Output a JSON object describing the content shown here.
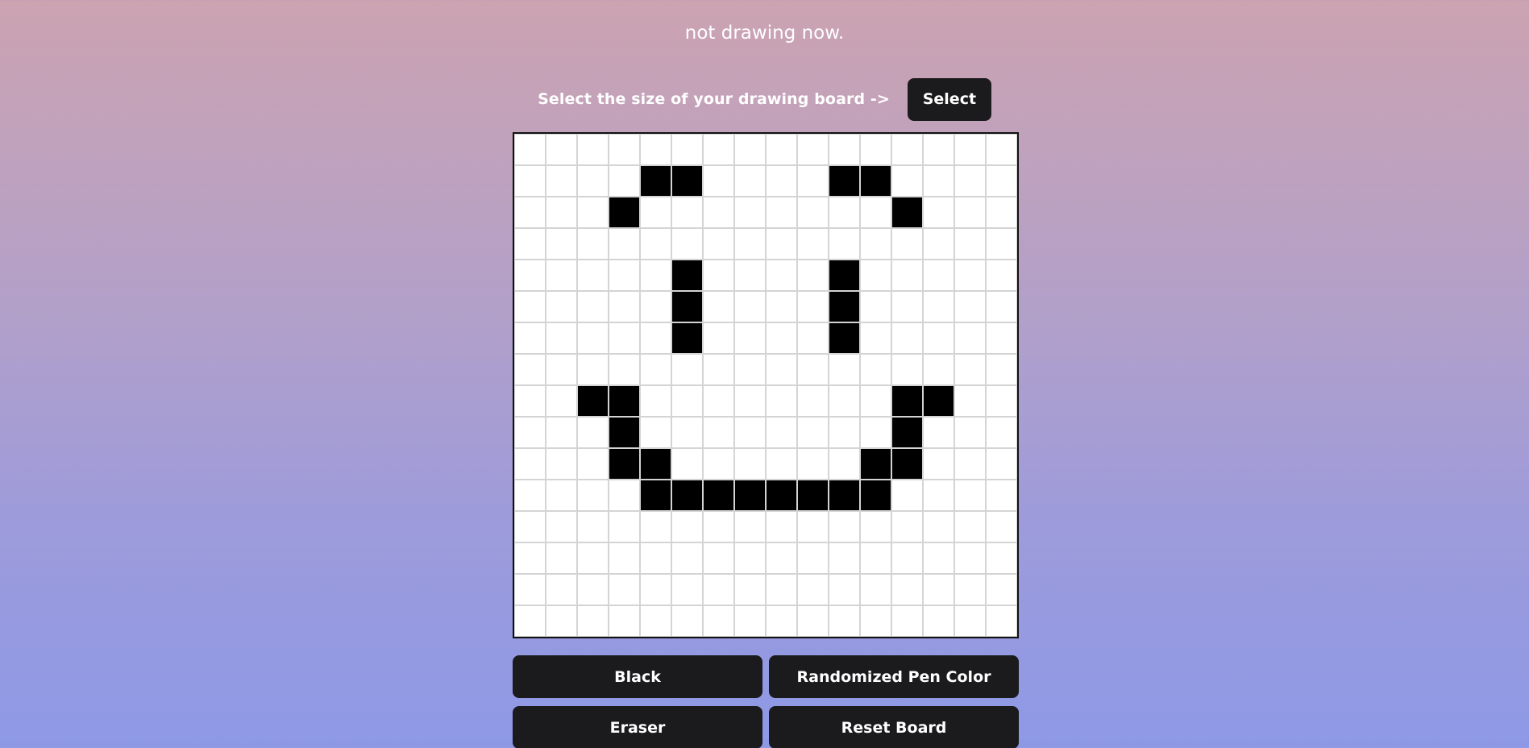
{
  "status": {
    "text": "not drawing now."
  },
  "board_picker": {
    "label": "Select the size of your drawing board ->",
    "button_label": "Select"
  },
  "board": {
    "size": 16,
    "filled_color": "#000000",
    "empty_color": "#ffffff",
    "grid_line_color": "#d4d4d4",
    "filled_cells": [
      [
        1,
        4
      ],
      [
        1,
        5
      ],
      [
        1,
        10
      ],
      [
        1,
        11
      ],
      [
        2,
        3
      ],
      [
        2,
        12
      ],
      [
        4,
        5
      ],
      [
        4,
        10
      ],
      [
        5,
        5
      ],
      [
        5,
        10
      ],
      [
        6,
        5
      ],
      [
        6,
        10
      ],
      [
        8,
        2
      ],
      [
        8,
        3
      ],
      [
        8,
        12
      ],
      [
        8,
        13
      ],
      [
        9,
        3
      ],
      [
        9,
        12
      ],
      [
        10,
        3
      ],
      [
        10,
        4
      ],
      [
        10,
        11
      ],
      [
        10,
        12
      ],
      [
        11,
        4
      ],
      [
        11,
        5
      ],
      [
        11,
        6
      ],
      [
        11,
        7
      ],
      [
        11,
        8
      ],
      [
        11,
        9
      ],
      [
        11,
        10
      ],
      [
        11,
        11
      ]
    ]
  },
  "controls": {
    "black_label": "Black",
    "random_label": "Randomized Pen Color",
    "eraser_label": "Eraser",
    "reset_label": "Reset Board"
  },
  "colors": {
    "button_bg": "#1b1b1d",
    "button_text": "#ffffff"
  }
}
